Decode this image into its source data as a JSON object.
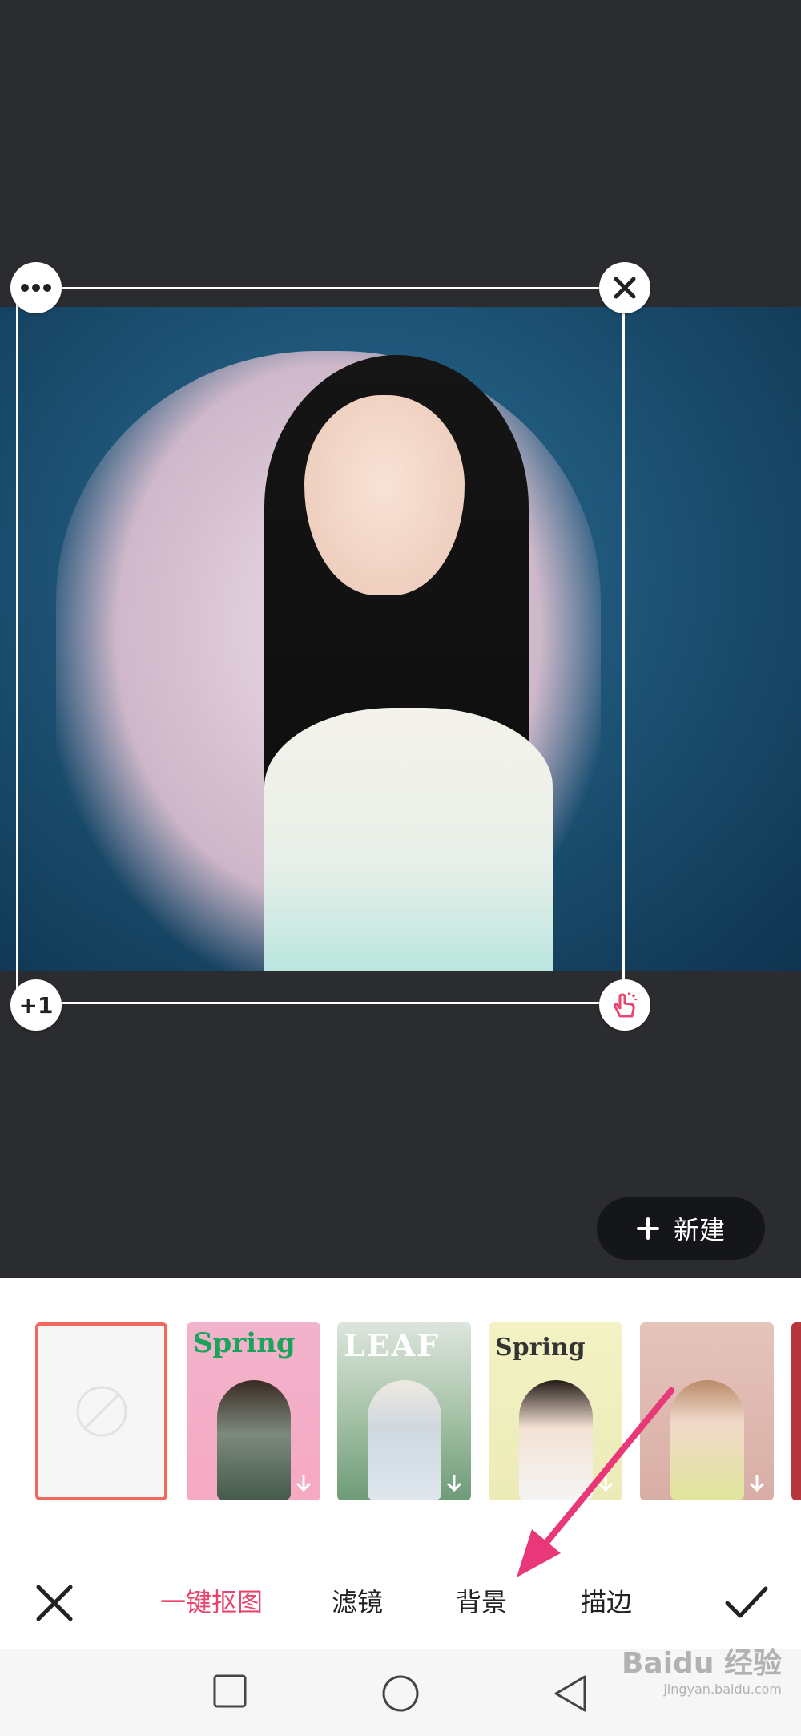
{
  "canvas": {
    "background_color": "#2b2c2f",
    "handles": {
      "more_icon": "more-dots-icon",
      "close_icon": "close-icon",
      "duplicate_label": "+1",
      "scale_icon": "rotate-scale-hand-icon"
    },
    "new_button": {
      "icon": "plus-icon",
      "label": "新建"
    }
  },
  "templates": {
    "items": [
      {
        "id": "none",
        "icon": "no-entry-icon",
        "selected": true
      },
      {
        "id": "spring-pink",
        "title": "Spring"
      },
      {
        "id": "leaf",
        "title": "LEAF"
      },
      {
        "id": "spring-yellow",
        "title": "Spring"
      },
      {
        "id": "pink-frame"
      },
      {
        "id": "red-partial"
      }
    ],
    "download_icon": "download-arrow-icon",
    "selected_border_color": "#ef6a5d"
  },
  "tabs": {
    "cancel_icon": "close-icon",
    "items": [
      {
        "label": "一键抠图",
        "active": true
      },
      {
        "label": "滤镜",
        "active": false
      },
      {
        "label": "背景",
        "active": false
      },
      {
        "label": "描边",
        "active": false
      }
    ],
    "confirm_icon": "checkmark-icon",
    "accent_color": "#e8466e"
  },
  "navbar": {
    "icons": [
      "recent-apps-square-icon",
      "home-circle-icon",
      "back-triangle-icon"
    ]
  },
  "watermark": {
    "text": "Baidu 经验",
    "sub": "jingyan.baidu.com"
  }
}
